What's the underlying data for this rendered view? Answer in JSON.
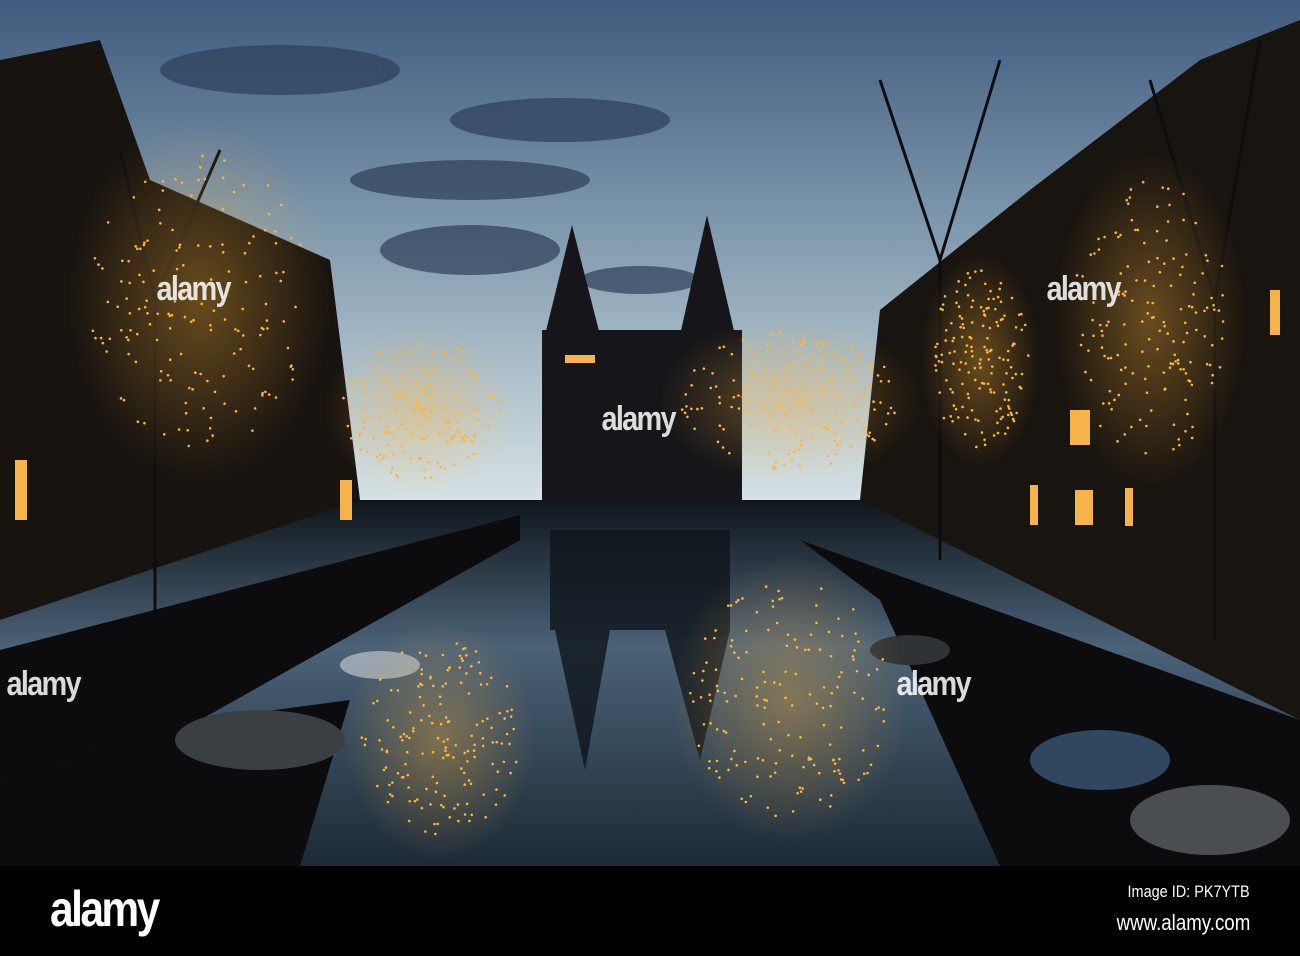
{
  "photo": {
    "subject": "canal-at-dusk",
    "colors": {
      "sky_top": "#4e6a8a",
      "sky_horizon": "#c9d8de",
      "lights": "#ffb53a",
      "water": "#1c2a36"
    }
  },
  "watermark": {
    "text": "alamy"
  },
  "footer": {
    "logo": "alamy",
    "image_id": "Image ID: PK7YTB",
    "url": "www.alamy.com"
  }
}
